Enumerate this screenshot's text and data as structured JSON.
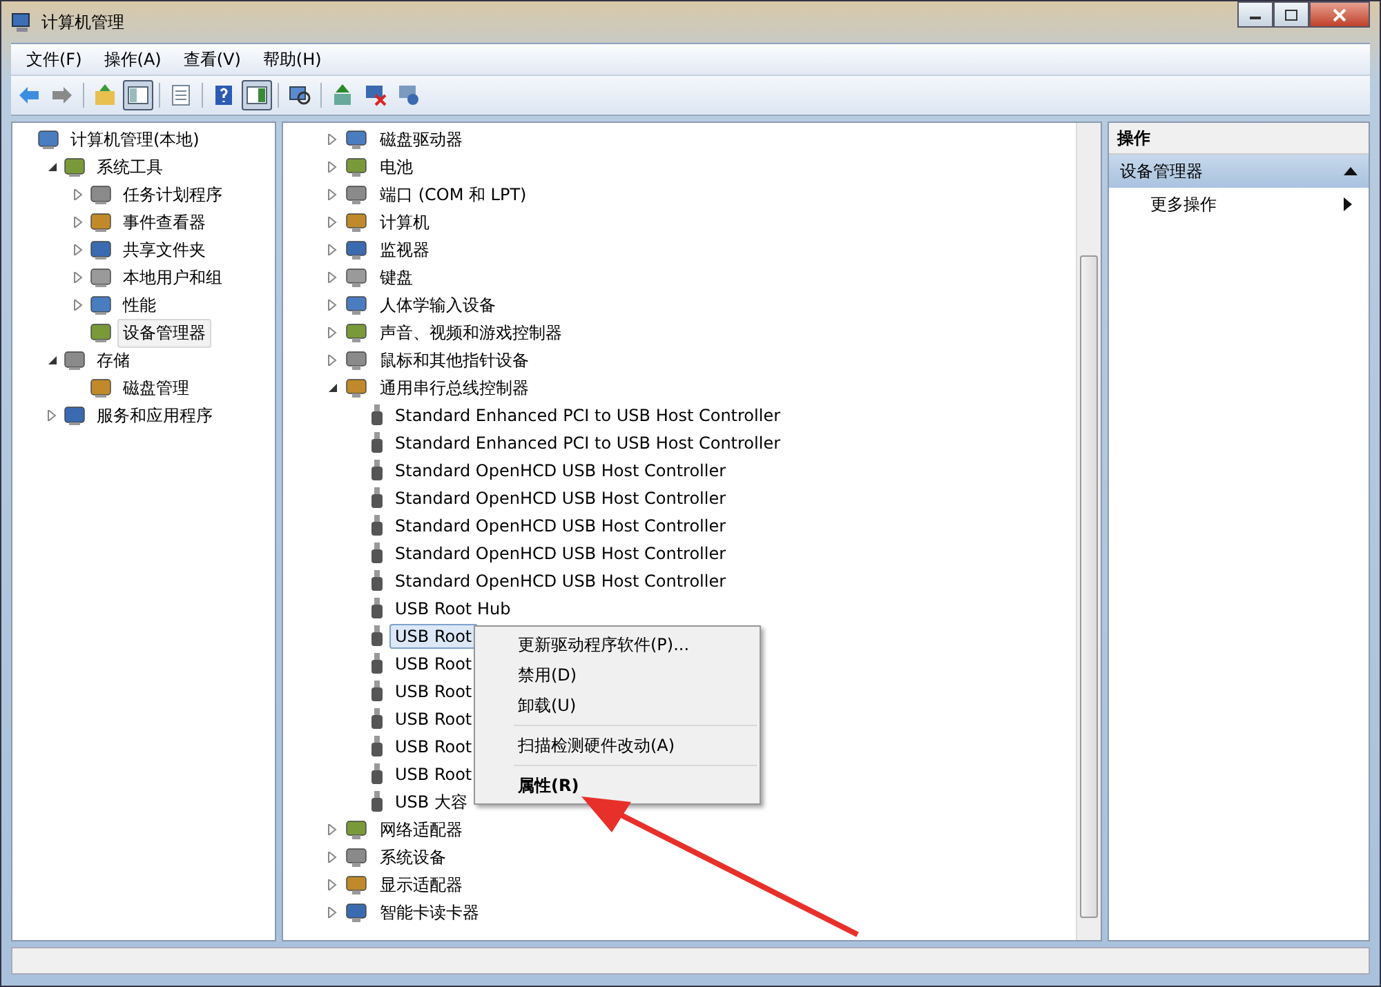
{
  "window": {
    "title": "计算机管理"
  },
  "menu": [
    "文件(F)",
    "操作(A)",
    "查看(V)",
    "帮助(H)"
  ],
  "toolbar": [
    {
      "kind": "back",
      "pressed": false
    },
    {
      "kind": "forward",
      "pressed": false
    },
    {
      "kind": "sep"
    },
    {
      "kind": "up",
      "pressed": false
    },
    {
      "kind": "tree",
      "pressed": true
    },
    {
      "kind": "sep"
    },
    {
      "kind": "list",
      "pressed": false
    },
    {
      "kind": "sep"
    },
    {
      "kind": "help",
      "pressed": false
    },
    {
      "kind": "pane",
      "pressed": true
    },
    {
      "kind": "sep"
    },
    {
      "kind": "scan",
      "pressed": false
    },
    {
      "kind": "sep"
    },
    {
      "kind": "update",
      "pressed": false
    },
    {
      "kind": "remove",
      "pressed": false
    },
    {
      "kind": "install",
      "pressed": false
    }
  ],
  "nav_tree": [
    {
      "label": "计算机管理(本地)",
      "selected": false,
      "children": [
        {
          "label": "系统工具",
          "expanded": true,
          "selected": false,
          "children": [
            {
              "label": "任务计划程序",
              "expanded": false,
              "selected": false
            },
            {
              "label": "事件查看器",
              "expanded": false,
              "selected": false
            },
            {
              "label": "共享文件夹",
              "expanded": false,
              "selected": false
            },
            {
              "label": "本地用户和组",
              "expanded": false,
              "selected": false
            },
            {
              "label": "性能",
              "expanded": false,
              "selected": false
            },
            {
              "label": "设备管理器",
              "selected": true
            }
          ]
        },
        {
          "label": "存储",
          "expanded": true,
          "selected": false,
          "children": [
            {
              "label": "磁盘管理",
              "selected": false
            }
          ]
        },
        {
          "label": "服务和应用程序",
          "expanded": false,
          "selected": false
        }
      ]
    }
  ],
  "device_tree": [
    {
      "label": "磁盘驱动器",
      "expanded": false,
      "selected": false
    },
    {
      "label": "电池",
      "expanded": false,
      "selected": false
    },
    {
      "label": "端口 (COM 和 LPT)",
      "expanded": false,
      "selected": false
    },
    {
      "label": "计算机",
      "expanded": false,
      "selected": false
    },
    {
      "label": "监视器",
      "expanded": false,
      "selected": false
    },
    {
      "label": "键盘",
      "expanded": false,
      "selected": false
    },
    {
      "label": "人体学输入设备",
      "expanded": false,
      "selected": false
    },
    {
      "label": "声音、视频和游戏控制器",
      "expanded": false,
      "selected": false
    },
    {
      "label": "鼠标和其他指针设备",
      "expanded": false,
      "selected": false
    },
    {
      "label": "通用串行总线控制器",
      "expanded": true,
      "selected": false,
      "children": [
        {
          "label": "Standard Enhanced PCI to USB Host Controller",
          "selected": false
        },
        {
          "label": "Standard Enhanced PCI to USB Host Controller",
          "selected": false
        },
        {
          "label": "Standard OpenHCD USB Host Controller",
          "selected": false
        },
        {
          "label": "Standard OpenHCD USB Host Controller",
          "selected": false
        },
        {
          "label": "Standard OpenHCD USB Host Controller",
          "selected": false
        },
        {
          "label": "Standard OpenHCD USB Host Controller",
          "selected": false
        },
        {
          "label": "Standard OpenHCD USB Host Controller",
          "selected": false
        },
        {
          "label": "USB Root Hub",
          "selected": false
        },
        {
          "label": "USB Root",
          "selected": true
        },
        {
          "label": "USB Root",
          "selected": false
        },
        {
          "label": "USB Root",
          "selected": false
        },
        {
          "label": "USB Root",
          "selected": false
        },
        {
          "label": "USB Root",
          "selected": false
        },
        {
          "label": "USB Root",
          "selected": false
        },
        {
          "label": "USB 大容",
          "selected": false
        }
      ]
    },
    {
      "label": "网络适配器",
      "expanded": false,
      "selected": false
    },
    {
      "label": "系统设备",
      "expanded": false,
      "selected": false
    },
    {
      "label": "显示适配器",
      "expanded": false,
      "selected": false
    },
    {
      "label": "智能卡读卡器",
      "expanded": false,
      "selected": false
    }
  ],
  "context_menu": [
    {
      "kind": "item",
      "label": "更新驱动程序软件(P)...",
      "default": false
    },
    {
      "kind": "item",
      "label": "禁用(D)",
      "default": false
    },
    {
      "kind": "item",
      "label": "卸载(U)",
      "default": false
    },
    {
      "kind": "separator"
    },
    {
      "kind": "item",
      "label": "扫描检测硬件改动(A)",
      "default": false
    },
    {
      "kind": "separator"
    },
    {
      "kind": "item",
      "label": "属性(R)",
      "default": true
    }
  ],
  "actions": {
    "title": "操作",
    "section": {
      "label": "设备管理器",
      "expanded": true
    },
    "items": [
      {
        "label": "更多操作"
      }
    ]
  }
}
